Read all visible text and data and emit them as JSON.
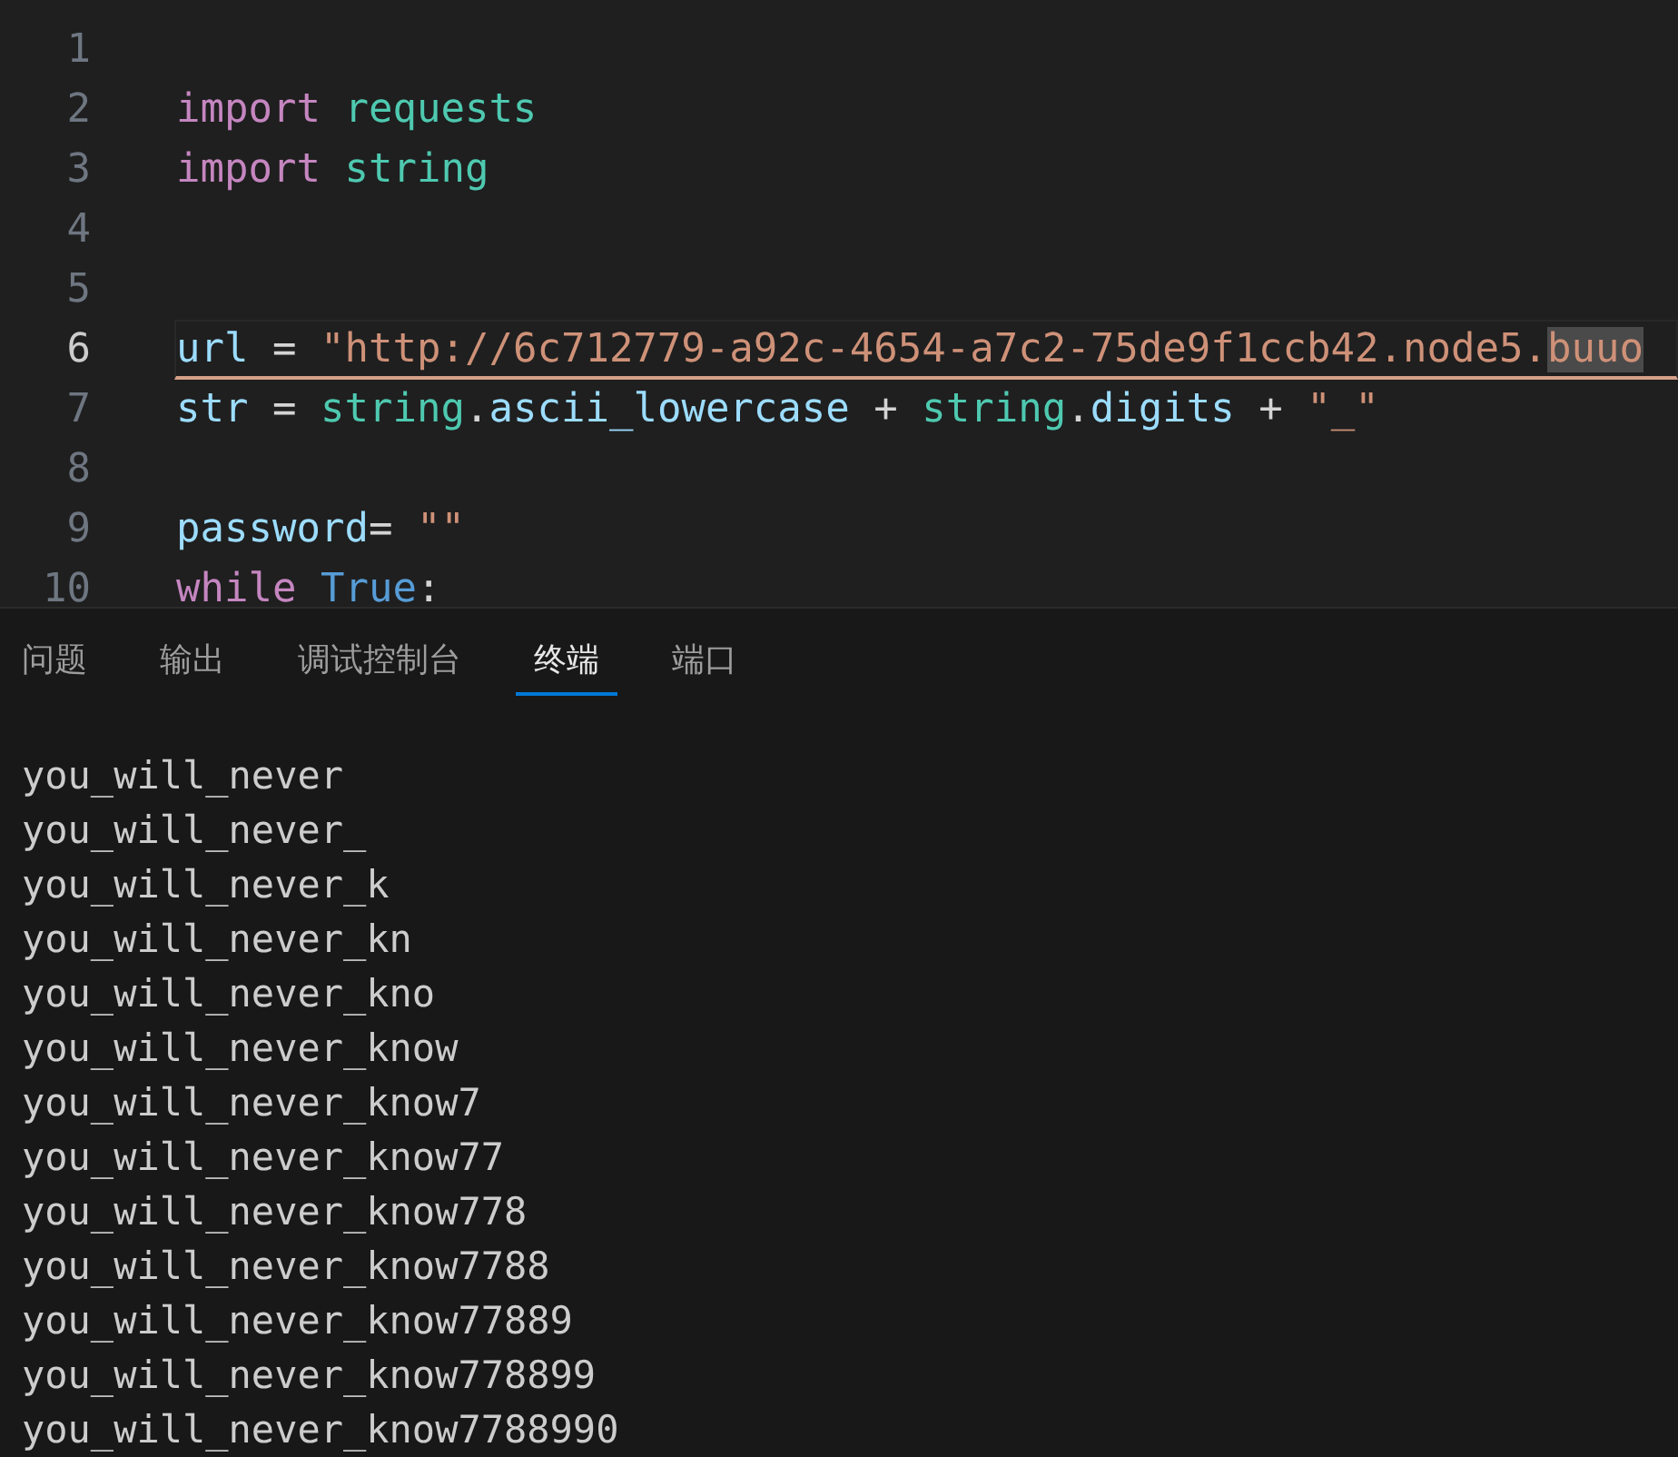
{
  "editor": {
    "lines": [
      {
        "number": "1",
        "current": false
      },
      {
        "number": "2",
        "current": false,
        "tokens": [
          {
            "kind": "keyword",
            "text": "import"
          },
          {
            "kind": "module",
            "text": "requests",
            "space_before": true
          }
        ]
      },
      {
        "number": "3",
        "current": false,
        "tokens": [
          {
            "kind": "keyword",
            "text": "import"
          },
          {
            "kind": "module",
            "text": "string",
            "space_before": true
          }
        ]
      },
      {
        "number": "4",
        "current": false
      },
      {
        "number": "5",
        "current": false
      },
      {
        "number": "6",
        "current": true,
        "tokens": [
          {
            "kind": "variable",
            "text": "url"
          },
          {
            "kind": "plain",
            "text": " = "
          },
          {
            "kind": "string",
            "text": "\"http://6c712779-a92c-4654-a7c2-75de9f1ccb42.node5."
          },
          {
            "kind": "string",
            "text": "buuo",
            "highlighted": true
          }
        ]
      },
      {
        "number": "7",
        "current": false,
        "tokens": [
          {
            "kind": "variable",
            "text": "str"
          },
          {
            "kind": "plain",
            "text": " = "
          },
          {
            "kind": "module",
            "text": "string"
          },
          {
            "kind": "plain",
            "text": "."
          },
          {
            "kind": "variable",
            "text": "ascii_lowercase"
          },
          {
            "kind": "plain",
            "text": " + "
          },
          {
            "kind": "module",
            "text": "string"
          },
          {
            "kind": "plain",
            "text": "."
          },
          {
            "kind": "variable",
            "text": "digits"
          },
          {
            "kind": "plain",
            "text": " + "
          },
          {
            "kind": "string",
            "text": "\"_\""
          }
        ]
      },
      {
        "number": "8",
        "current": false
      },
      {
        "number": "9",
        "current": false,
        "tokens": [
          {
            "kind": "variable",
            "text": "password"
          },
          {
            "kind": "plain",
            "text": "="
          },
          {
            "kind": "string",
            "text": "\"\"",
            "space_before": true
          }
        ]
      },
      {
        "number": "10",
        "current": false,
        "tokens": [
          {
            "kind": "keyword",
            "text": "while"
          },
          {
            "kind": "constant",
            "text": "True",
            "space_before": true
          },
          {
            "kind": "plain",
            "text": ":"
          }
        ]
      }
    ]
  },
  "panel": {
    "tabs": [
      {
        "label": "问题",
        "selected": false
      },
      {
        "label": "输出",
        "selected": false
      },
      {
        "label": "调试控制台",
        "selected": false
      },
      {
        "label": "终端",
        "selected": true
      },
      {
        "label": "端口",
        "selected": false
      }
    ],
    "terminal_lines": [
      "you_will_never",
      "you_will_never_",
      "you_will_never_k",
      "you_will_never_kn",
      "you_will_never_kno",
      "you_will_never_know",
      "you_will_never_know7",
      "you_will_never_know77",
      "you_will_never_know778",
      "you_will_never_know7788",
      "you_will_never_know77889",
      "you_will_never_know778899",
      "you_will_never_know7788990"
    ]
  }
}
